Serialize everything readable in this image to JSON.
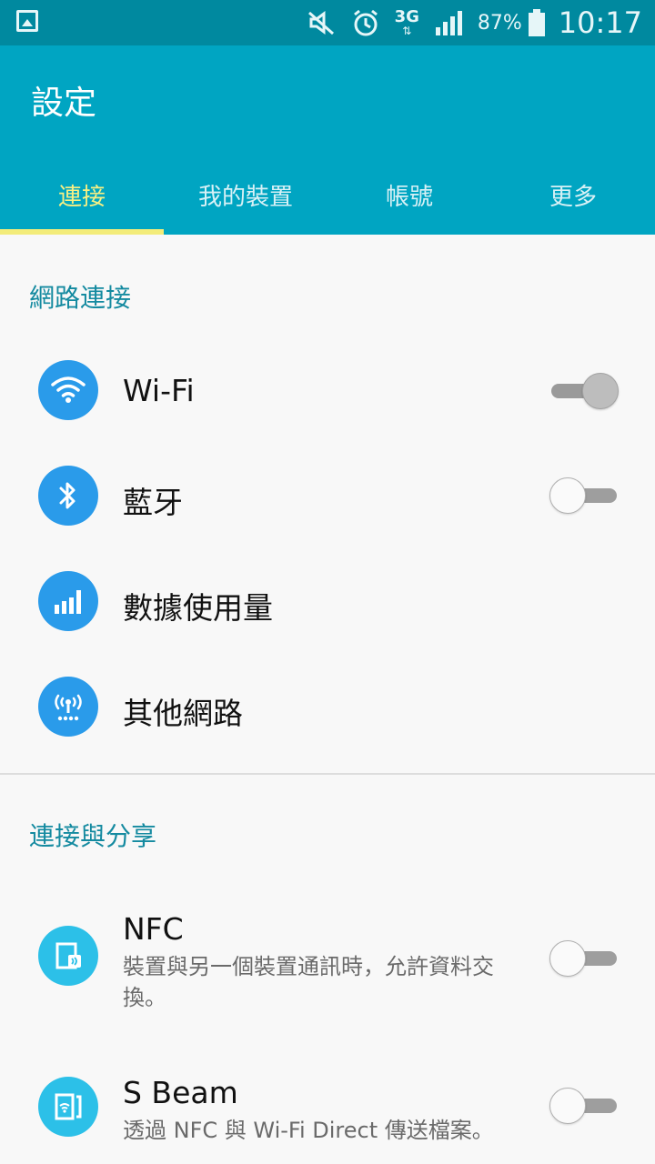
{
  "status_bar": {
    "left_icon": "gallery-icon",
    "icons": [
      "mute-icon",
      "alarm-icon",
      "network-3g-icon",
      "signal-icon"
    ],
    "network_type": "3G",
    "battery_percent": "87%",
    "time": "10:17"
  },
  "header": {
    "title": "設定",
    "tabs": [
      {
        "label": "連接",
        "active": true
      },
      {
        "label": "我的裝置",
        "active": false
      },
      {
        "label": "帳號",
        "active": false
      },
      {
        "label": "更多",
        "active": false
      }
    ]
  },
  "sections": [
    {
      "title": "網路連接",
      "items": [
        {
          "label": "Wi-Fi",
          "icon": "wifi-icon",
          "switch": "on"
        },
        {
          "label": "藍牙",
          "icon": "bluetooth-icon",
          "switch": "off"
        },
        {
          "label": "數據使用量",
          "icon": "data-usage-icon"
        },
        {
          "label": "其他網路",
          "icon": "other-networks-icon"
        }
      ]
    },
    {
      "title": "連接與分享",
      "items": [
        {
          "label": "NFC",
          "subtitle": "裝置與另一個裝置通訊時，允許資料交換。",
          "icon": "nfc-icon",
          "switch": "off"
        },
        {
          "label": "S Beam",
          "subtitle": "透過 NFC 與 Wi-Fi Direct 傳送檔案。",
          "icon": "s-beam-icon",
          "switch": "off"
        }
      ]
    }
  ],
  "colors": {
    "status_bar": "#00899f",
    "app_bar": "#00a5c2",
    "active_tab": "#f7f084",
    "section_header": "#148aa0",
    "icon_blue": "#2a9bea",
    "icon_cyan": "#2cc0e8"
  }
}
